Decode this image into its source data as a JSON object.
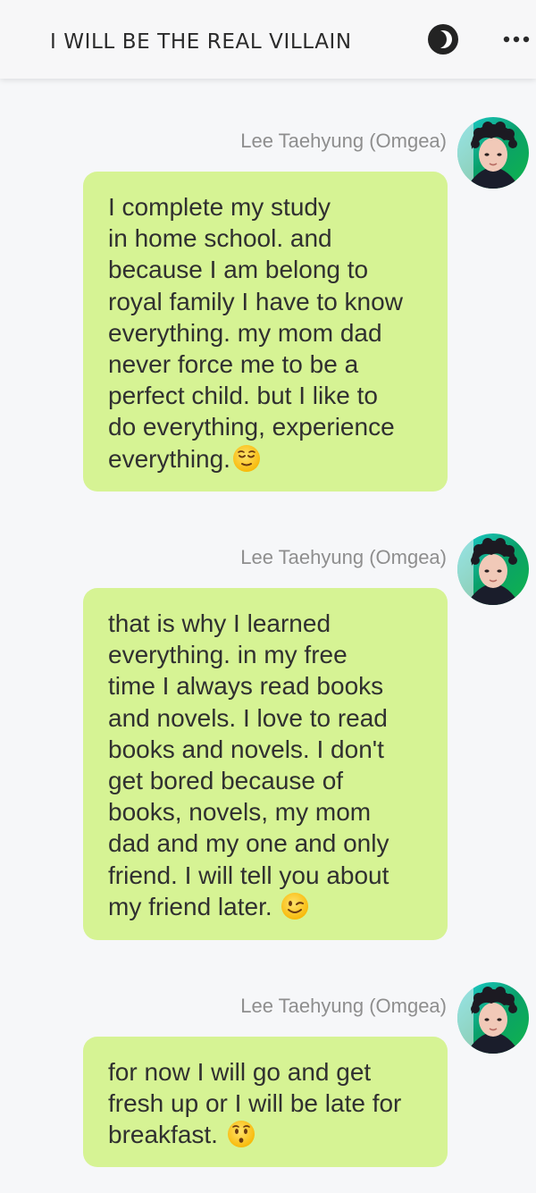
{
  "header": {
    "title": "I WILL BE THE REAL VILLAIN",
    "mode_icon": "half-moon-icon",
    "more_icon": "more-dots-icon"
  },
  "messages": [
    {
      "sender": "Lee Taehyung (Omgea)",
      "lines": [
        "I complete my study",
        "in home school. and",
        "because I am belong to",
        "royal family I have to know",
        "everything. my mom dad",
        "never force me to be a",
        "perfect child. but I like to",
        "do everything, experience",
        "everything."
      ],
      "emoji": "relieved-face"
    },
    {
      "sender": "Lee Taehyung (Omgea)",
      "lines": [
        "that is why I learned",
        "everything. in my free",
        "time I always read books",
        "and novels. I love to read",
        "books and novels. I don't",
        "get bored because of",
        "books, novels, my mom",
        "dad and my one and only",
        "friend. I will tell you about",
        "my friend later. "
      ],
      "emoji": "winking-face"
    },
    {
      "sender": "Lee Taehyung (Omgea)",
      "lines": [
        "for now I will go and get",
        "fresh up or I will be late for",
        "breakfast. "
      ],
      "emoji": "kissing-face"
    }
  ],
  "colors": {
    "background": "#f6f7f9",
    "bubble": "#d6f394",
    "sender_text": "#8e8e8e",
    "message_text": "#303030"
  }
}
